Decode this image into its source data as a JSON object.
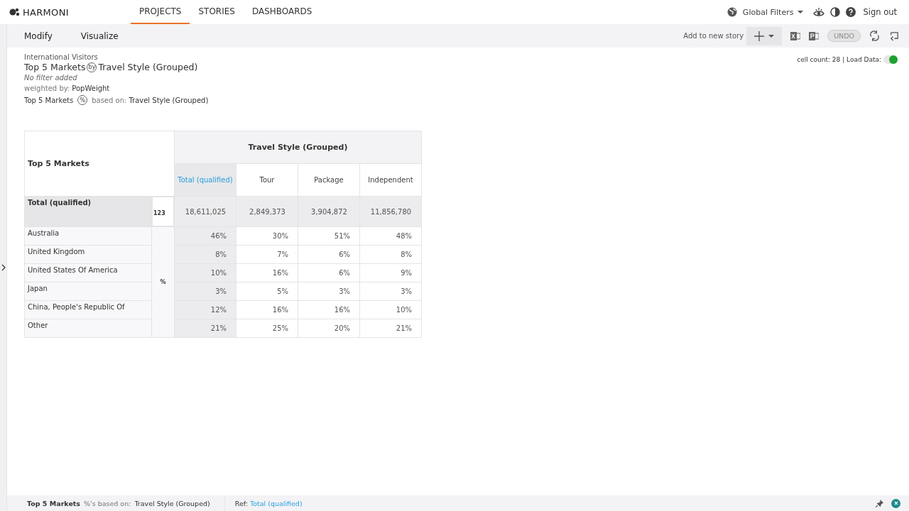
{
  "app": {
    "name": "HARMONI"
  },
  "nav": [
    {
      "label": "PROJECTS",
      "selected": true
    },
    {
      "label": "STORIES",
      "selected": false
    },
    {
      "label": "DASHBOARDS",
      "selected": false
    }
  ],
  "header_right": {
    "global_filters": "Global Filters",
    "sign_out": "Sign out"
  },
  "toolbar": {
    "tabs": [
      {
        "label": "Modify",
        "selected": false
      },
      {
        "label": "Visualize",
        "selected": false
      }
    ],
    "add_story": "Add to new story",
    "undo": "UNDO"
  },
  "info": {
    "dataset": "International Visitors",
    "rows_var": "Top 5 Markets",
    "by": "by",
    "cols_var": "Travel Style (Grouped)",
    "filter": "No filter added",
    "weighted_label": "weighted by:",
    "weight": "PopWeight",
    "pct_rows": "Top 5 Markets",
    "pct_icon": "%",
    "based_on": "based on:",
    "pct_cols": "Travel Style (Grouped)"
  },
  "load": {
    "cell_count": "cell count: 28 | Load Data:",
    "on": true
  },
  "table": {
    "row_header": "Top 5 Markets",
    "col_group": "Travel Style (Grouped)",
    "columns": [
      {
        "label": "Total (qualified)",
        "ref": true
      },
      {
        "label": "Tour",
        "ref": false
      },
      {
        "label": "Package",
        "ref": false
      },
      {
        "label": "Independent",
        "ref": false
      }
    ],
    "total": {
      "label": "Total (qualified)",
      "stat": "123",
      "values": [
        "18,611,025",
        "2,849,373",
        "3,904,872",
        "11,856,780"
      ]
    },
    "stat": "%",
    "rows": [
      {
        "label": "Australia",
        "values": [
          "46%",
          "30%",
          "51%",
          "48%"
        ]
      },
      {
        "label": "United Kingdom",
        "values": [
          "8%",
          "7%",
          "6%",
          "8%"
        ]
      },
      {
        "label": "United States Of America",
        "values": [
          "10%",
          "16%",
          "6%",
          "9%"
        ]
      },
      {
        "label": "Japan",
        "values": [
          "3%",
          "5%",
          "3%",
          "3%"
        ]
      },
      {
        "label": "China, People's Republic Of",
        "values": [
          "12%",
          "16%",
          "16%",
          "10%"
        ]
      },
      {
        "label": "Other",
        "values": [
          "21%",
          "25%",
          "20%",
          "21%"
        ]
      }
    ]
  },
  "status_bar": {
    "rows_var": "Top 5 Markets",
    "based_label": "%'s based on:",
    "cols_var": "Travel Style (Grouped)",
    "ref_label": "Ref:",
    "ref": "Total (qualified)"
  }
}
